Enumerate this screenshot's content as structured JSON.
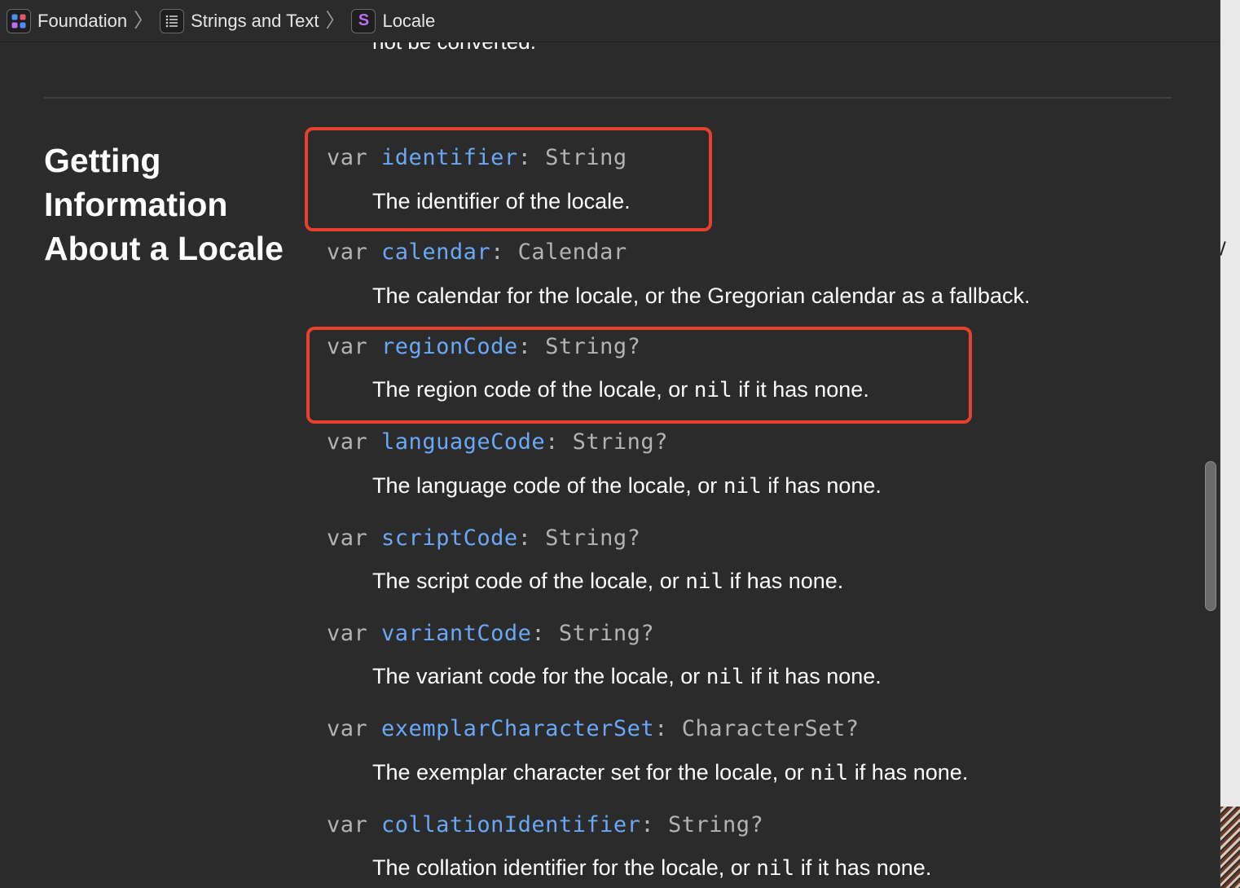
{
  "breadcrumb": {
    "items": [
      {
        "label": "Foundation",
        "icon": "framework-icon"
      },
      {
        "label": "Strings and Text",
        "icon": "list-icon"
      },
      {
        "label": "Locale",
        "icon": "struct-icon",
        "icon_glyph": "S"
      }
    ],
    "separator": "〉"
  },
  "cutoff_text": "not be converted.",
  "section": {
    "title": "Getting Information About a Locale"
  },
  "members": [
    {
      "keyword": "var",
      "name": "identifier",
      "colon": ":",
      "type": "String",
      "desc_before": "The identifier of the locale.",
      "desc_code": "",
      "desc_after": ""
    },
    {
      "keyword": "var",
      "name": "calendar",
      "colon": ":",
      "type": "Calendar",
      "desc_before": "The calendar for the locale, or the Gregorian calendar as a fallback.",
      "desc_code": "",
      "desc_after": ""
    },
    {
      "keyword": "var",
      "name": "regionCode",
      "colon": ":",
      "type": "String?",
      "desc_before": "The region code of the locale, or ",
      "desc_code": "nil",
      "desc_after": " if it has none."
    },
    {
      "keyword": "var",
      "name": "languageCode",
      "colon": ":",
      "type": "String?",
      "desc_before": "The language code of the locale, or ",
      "desc_code": "nil",
      "desc_after": " if has none."
    },
    {
      "keyword": "var",
      "name": "scriptCode",
      "colon": ":",
      "type": "String?",
      "desc_before": "The script code of the locale, or ",
      "desc_code": "nil",
      "desc_after": " if has none."
    },
    {
      "keyword": "var",
      "name": "variantCode",
      "colon": ":",
      "type": "String?",
      "desc_before": "The variant code for the locale, or ",
      "desc_code": "nil",
      "desc_after": " if it has none."
    },
    {
      "keyword": "var",
      "name": "exemplarCharacterSet",
      "colon": ":",
      "type": "CharacterSet?",
      "desc_before": "The exemplar character set for the locale, or ",
      "desc_code": "nil",
      "desc_after": " if has none."
    },
    {
      "keyword": "var",
      "name": "collationIdentifier",
      "colon": ":",
      "type": "String?",
      "desc_before": "The collation identifier for the locale, or ",
      "desc_code": "nil",
      "desc_after": " if it has none."
    }
  ],
  "colors": {
    "background": "#2b2b2b",
    "symbol_link": "#6aa8f7",
    "highlight_border": "#e7402f"
  }
}
